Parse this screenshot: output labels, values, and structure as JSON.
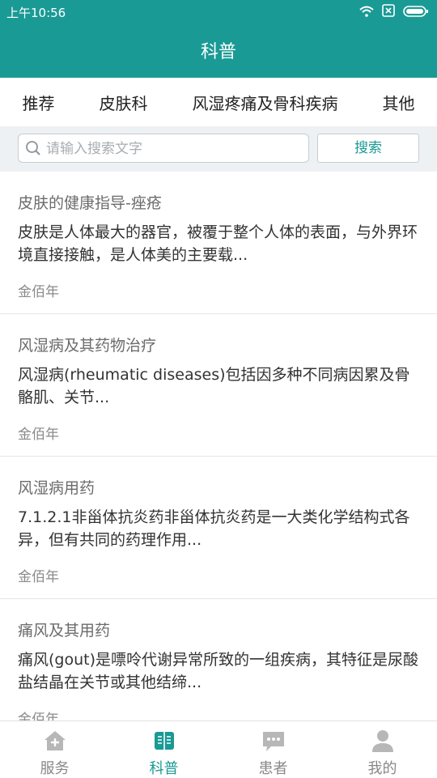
{
  "status": {
    "time": "上午10:56"
  },
  "header": {
    "title": "科普"
  },
  "tabs": [
    "推荐",
    "皮肤科",
    "风湿疼痛及骨科疾病",
    "其他"
  ],
  "search": {
    "placeholder": "请输入搜索文字",
    "button": "搜索"
  },
  "articles": [
    {
      "title": "皮肤的健康指导-痤疮",
      "summary": "皮肤是人体最大的器官，被覆于整个人体的表面，与外界环境直接接触，是人体美的主要载...",
      "author": "金佰年"
    },
    {
      "title": "风湿病及其药物治疗",
      "summary": "风湿病(rheumatic diseases)包括因多种不同病因累及骨骼肌、关节...",
      "author": "金佰年"
    },
    {
      "title": "风湿病用药",
      "summary": "7.1.2.1非甾体抗炎药非甾体抗炎药是一大类化学结构式各异，但有共同的药理作用...",
      "author": "金佰年"
    },
    {
      "title": "痛风及其用药",
      "summary": "痛风(gout)是嘌呤代谢异常所致的一组疾病，其特征是尿酸盐结晶在关节或其他结缔...",
      "author": "金佰年"
    }
  ],
  "nav": {
    "items": [
      {
        "label": "服务",
        "icon": "home-plus-icon"
      },
      {
        "label": "科普",
        "icon": "book-icon"
      },
      {
        "label": "患者",
        "icon": "chat-icon"
      },
      {
        "label": "我的",
        "icon": "person-icon"
      }
    ],
    "active_index": 1
  },
  "colors": {
    "brand": "#1a9a95",
    "inactive_icon": "#b7b7b7"
  }
}
